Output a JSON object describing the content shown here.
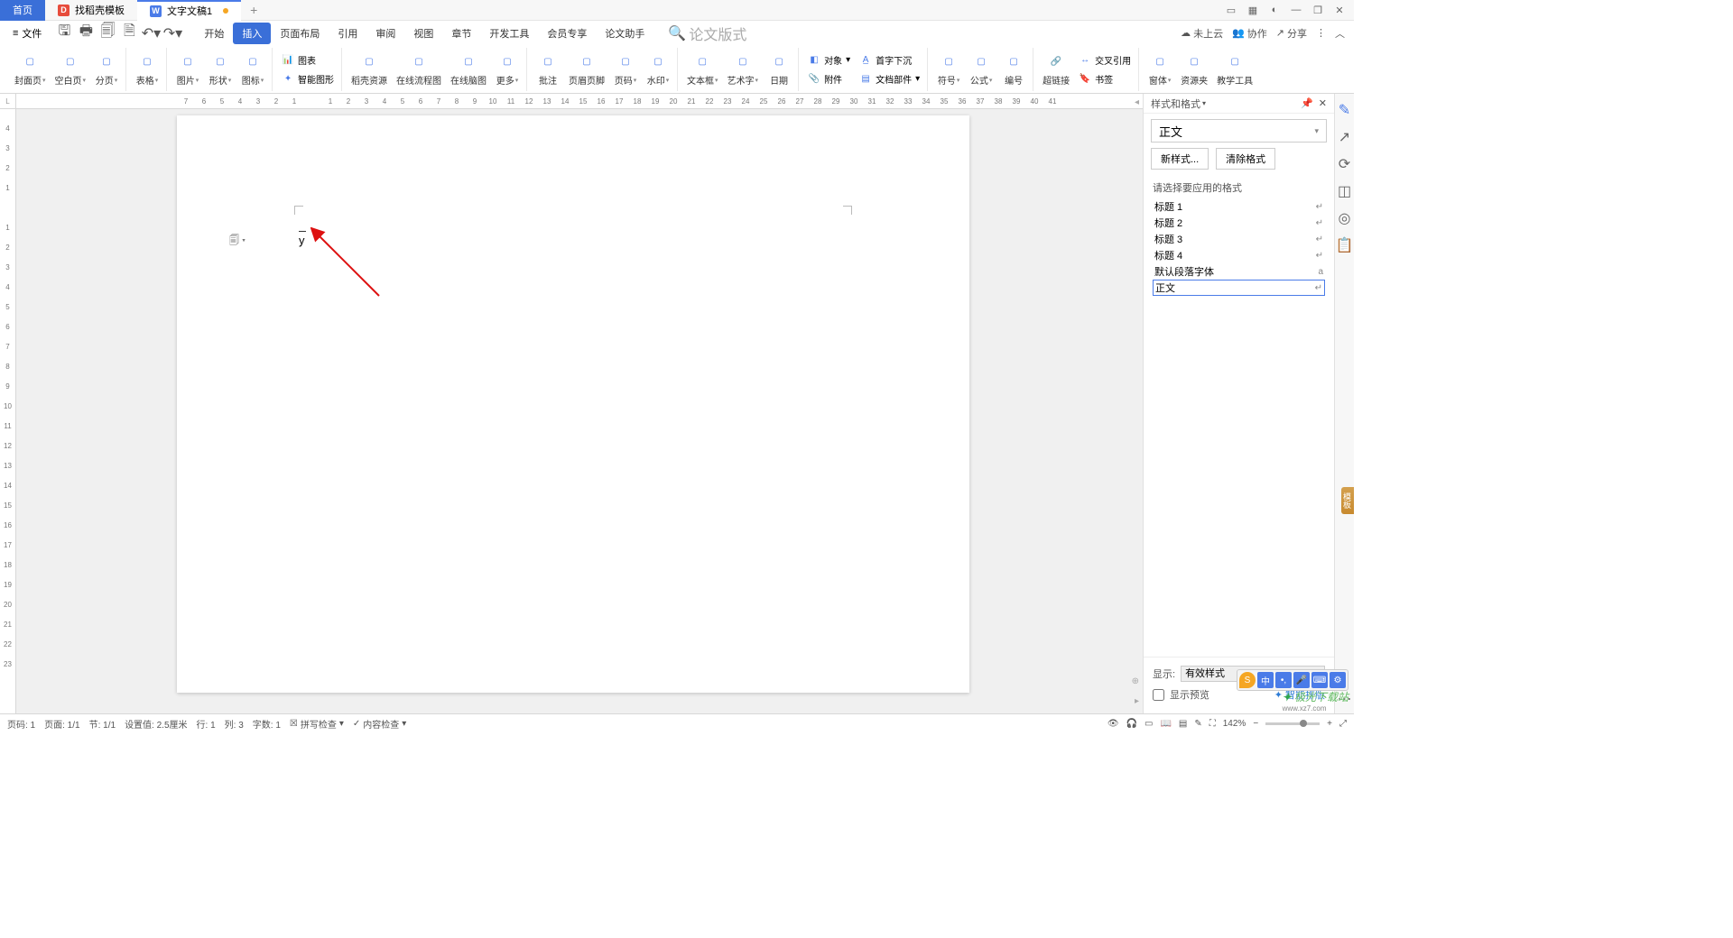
{
  "titlebar": {
    "tabs": [
      {
        "label": "首页",
        "kind": "home"
      },
      {
        "label": "找稻壳模板",
        "kind": "red"
      },
      {
        "label": "文字文稿1",
        "kind": "blue",
        "modified": true
      }
    ]
  },
  "menu": {
    "file": "文件",
    "tabs": [
      "开始",
      "插入",
      "页面布局",
      "引用",
      "审阅",
      "视图",
      "章节",
      "开发工具",
      "会员专享",
      "论文助手"
    ],
    "active_tab": 1,
    "search_placeholder": "论文版式",
    "right": {
      "cloud": "未上云",
      "collab": "协作",
      "share": "分享"
    }
  },
  "ribbon": {
    "large": [
      {
        "label": "封面页",
        "caret": true
      },
      {
        "label": "空白页",
        "caret": true
      },
      {
        "label": "分页",
        "caret": true
      },
      {
        "label": "表格",
        "caret": true
      },
      {
        "label": "图片",
        "caret": true
      },
      {
        "label": "形状",
        "caret": true
      },
      {
        "label": "图标",
        "caret": true
      }
    ],
    "chart_group": {
      "chart": "图表",
      "smart": "智能图形"
    },
    "assets": [
      {
        "label": "稻壳资源"
      },
      {
        "label": "在线流程图"
      },
      {
        "label": "在线脑图"
      },
      {
        "label": "更多",
        "caret": true
      }
    ],
    "mid": [
      {
        "label": "批注"
      },
      {
        "label": "页眉页脚"
      },
      {
        "label": "页码",
        "caret": true
      },
      {
        "label": "水印",
        "caret": true
      }
    ],
    "textbox": [
      {
        "label": "文本框",
        "caret": true
      },
      {
        "label": "艺术字",
        "caret": true
      },
      {
        "label": "日期"
      }
    ],
    "attach_group": {
      "object": "对象",
      "cap": "首字下沉",
      "attachment": "附件",
      "parts": "文档部件"
    },
    "symbols": [
      {
        "label": "符号",
        "caret": true
      },
      {
        "label": "公式",
        "caret": true
      },
      {
        "label": "编号"
      }
    ],
    "link_group": {
      "hyper": "超链接",
      "cross": "交叉引用",
      "bm": "书签"
    },
    "last": [
      {
        "label": "窗体",
        "caret": true
      },
      {
        "label": "资源夹"
      },
      {
        "label": "教学工具"
      }
    ]
  },
  "hruler_ticks": [
    "7",
    "6",
    "5",
    "4",
    "3",
    "2",
    "1",
    "",
    "1",
    "2",
    "3",
    "4",
    "5",
    "6",
    "7",
    "8",
    "9",
    "10",
    "11",
    "12",
    "13",
    "14",
    "15",
    "16",
    "17",
    "18",
    "19",
    "20",
    "21",
    "22",
    "23",
    "24",
    "25",
    "26",
    "27",
    "28",
    "29",
    "30",
    "31",
    "32",
    "33",
    "34",
    "35",
    "36",
    "37",
    "38",
    "39",
    "40",
    "41"
  ],
  "vruler_ticks": [
    "4",
    "3",
    "2",
    "1",
    "",
    "1",
    "2",
    "3",
    "4",
    "5",
    "6",
    "7",
    "8",
    "9",
    "10",
    "11",
    "12",
    "13",
    "14",
    "15",
    "16",
    "17",
    "18",
    "19",
    "20",
    "21",
    "22",
    "23"
  ],
  "corner_label": "L",
  "doc_char": "y",
  "panel": {
    "title": "样式和格式",
    "current": "正文",
    "new_btn": "新样式...",
    "clear_btn": "清除格式",
    "pick_label": "请选择要应用的格式",
    "items": [
      {
        "label": "标题 1"
      },
      {
        "label": "标题 2"
      },
      {
        "label": "标题 3"
      },
      {
        "label": "标题 4"
      },
      {
        "label": "默认段落字体",
        "suffix": "a"
      },
      {
        "label": "正文",
        "selected": true
      }
    ],
    "show_label": "显示:",
    "show_value": "有效样式",
    "preview": "显示预览",
    "smart": "智能排版"
  },
  "status": {
    "page_no": "页码: 1",
    "page": "页面: 1/1",
    "section": "节: 1/1",
    "pos": "设置值: 2.5厘米",
    "row": "行: 1",
    "col": "列: 3",
    "chars": "字数: 1",
    "spell": "拼写检查",
    "content": "内容检查",
    "zoom": "142%"
  },
  "watermark": {
    "brand": "极光下载站",
    "url": "www.xz7.com"
  },
  "ime": [
    "中",
    "•,",
    "",
    "",
    ""
  ]
}
